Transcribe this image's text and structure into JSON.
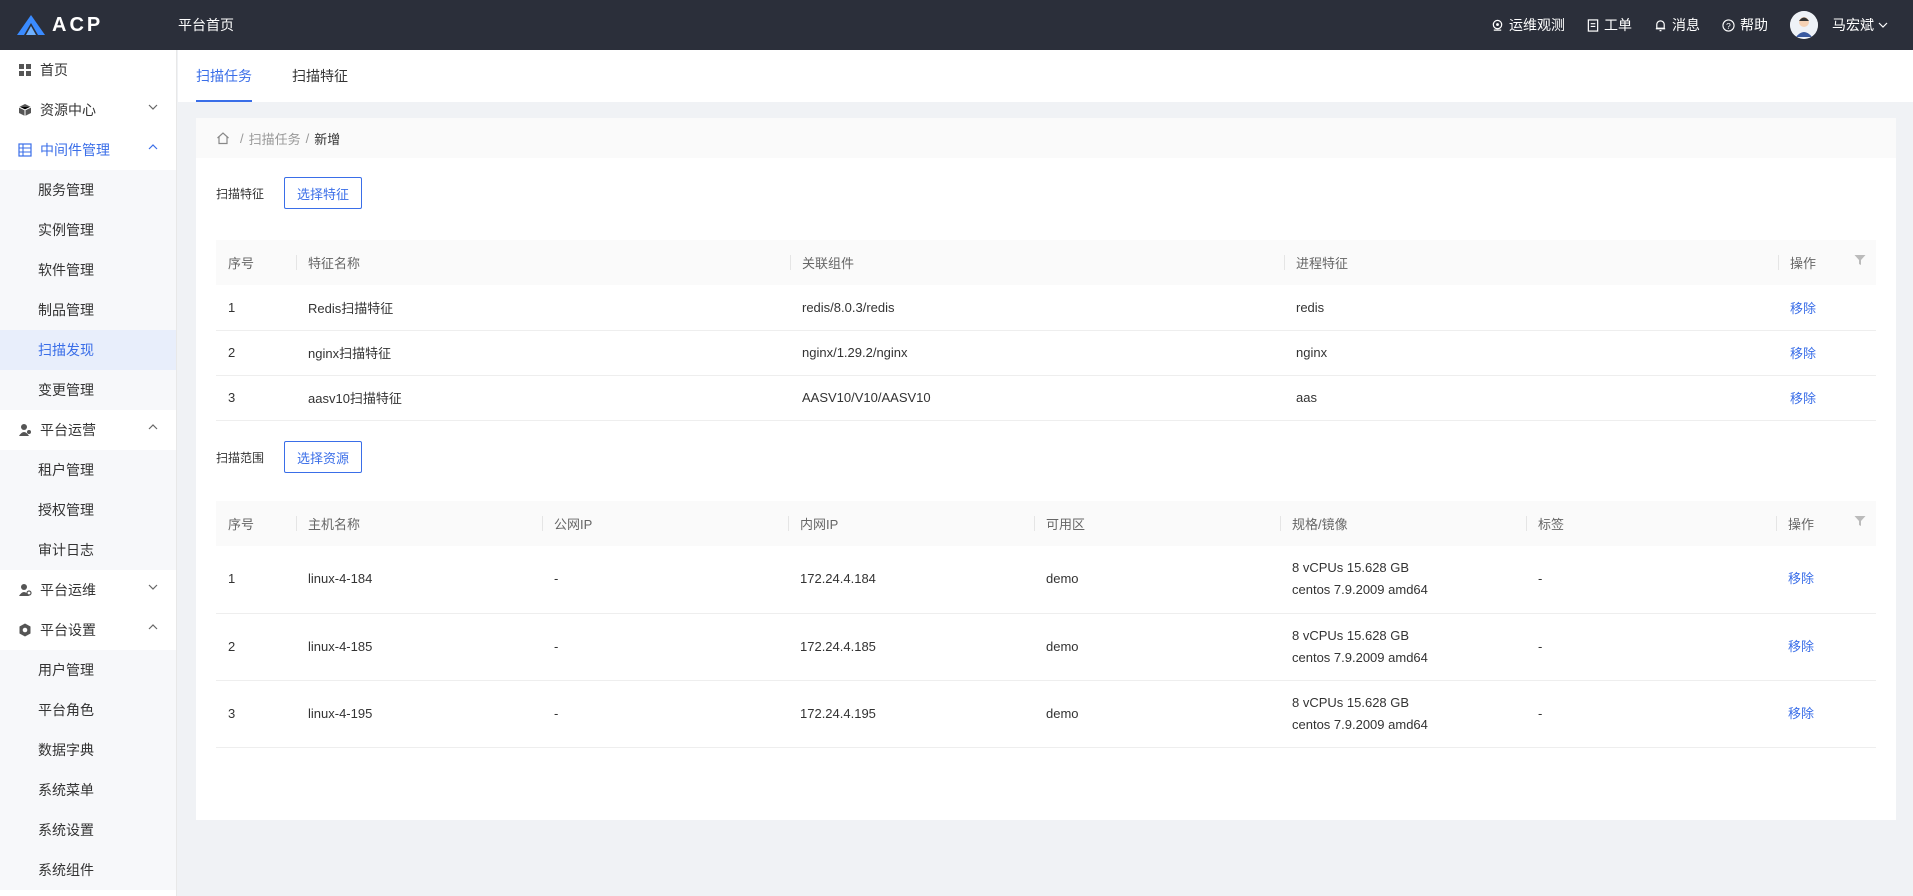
{
  "header": {
    "logo_text": "ACP",
    "title": "平台首页",
    "nav": [
      {
        "label": "运维观测",
        "icon": "observe-icon"
      },
      {
        "label": "工单",
        "icon": "ticket-icon"
      },
      {
        "label": "消息",
        "icon": "bell-icon"
      },
      {
        "label": "帮助",
        "icon": "help-icon"
      }
    ],
    "user_name": "马宏斌",
    "accent": "#3a6ee8",
    "bg": "#2b2f3a"
  },
  "sidebar": {
    "items": [
      {
        "label": "首页"
      },
      {
        "label": "资源中心"
      },
      {
        "label": "中间件管理",
        "children": [
          "服务管理",
          "实例管理",
          "软件管理",
          "制品管理",
          "扫描发现",
          "变更管理"
        ],
        "selected": "扫描发现"
      },
      {
        "label": "平台运营",
        "children": [
          "租户管理",
          "授权管理",
          "审计日志"
        ]
      },
      {
        "label": "平台运维"
      },
      {
        "label": "平台设置",
        "children": [
          "用户管理",
          "平台角色",
          "数据字典",
          "系统菜单",
          "系统设置",
          "系统组件"
        ]
      }
    ]
  },
  "tabs": [
    "扫描任务",
    "扫描特征"
  ],
  "breadcrumb": {
    "items": [
      "扫描任务"
    ],
    "current": "新增",
    "separator": "/"
  },
  "feature_section": {
    "label": "扫描特征",
    "button": "选择特征",
    "columns": [
      "序号",
      "特征名称",
      "关联组件",
      "进程特征",
      "操作"
    ],
    "rows": [
      {
        "no": "1",
        "name": "Redis扫描特征",
        "component": "redis/8.0.3/redis",
        "process": "redis",
        "action": "移除"
      },
      {
        "no": "2",
        "name": "nginx扫描特征",
        "component": "nginx/1.29.2/nginx",
        "process": "nginx",
        "action": "移除"
      },
      {
        "no": "3",
        "name": "aasv10扫描特征",
        "component": "AASV10/V10/AASV10",
        "process": "aas",
        "action": "移除"
      }
    ]
  },
  "resource_section": {
    "label": "扫描范围",
    "button": "选择资源",
    "columns": [
      "序号",
      "主机名称",
      "公网IP",
      "内网IP",
      "可用区",
      "规格/镜像",
      "标签",
      "操作"
    ],
    "rows": [
      {
        "no": "1",
        "host": "linux-4-184",
        "public_ip": "-",
        "private_ip": "172.24.4.184",
        "zone": "demo",
        "spec": "8 vCPUs 15.628 GB",
        "image": "centos 7.9.2009 amd64",
        "tag": "-",
        "action": "移除"
      },
      {
        "no": "2",
        "host": "linux-4-185",
        "public_ip": "-",
        "private_ip": "172.24.4.185",
        "zone": "demo",
        "spec": "8 vCPUs 15.628 GB",
        "image": "centos 7.9.2009 amd64",
        "tag": "-",
        "action": "移除"
      },
      {
        "no": "3",
        "host": "linux-4-195",
        "public_ip": "-",
        "private_ip": "172.24.4.195",
        "zone": "demo",
        "spec": "8 vCPUs 15.628 GB",
        "image": "centos 7.9.2009 amd64",
        "tag": "-",
        "action": "移除"
      }
    ]
  }
}
